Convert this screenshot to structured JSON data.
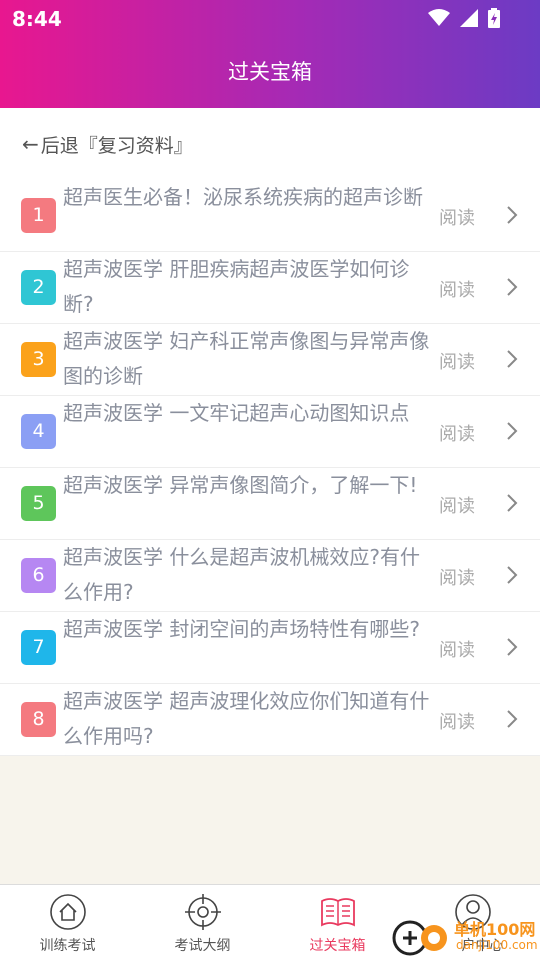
{
  "status": {
    "time": "8:44"
  },
  "header": {
    "title": "过关宝箱"
  },
  "back": {
    "arrow": "←",
    "label": "后退『复习资料』"
  },
  "read_label": "阅读",
  "items": [
    {
      "num": "1",
      "color": "#f47a80",
      "title": "超声医生必备！泌尿系统疾病的超声诊断"
    },
    {
      "num": "2",
      "color": "#2fc6d4",
      "title": "超声波医学 肝胆疾病超声波医学如何诊断?"
    },
    {
      "num": "3",
      "color": "#fba21b",
      "title": "超声波医学 妇产科正常声像图与异常声像图的诊断"
    },
    {
      "num": "4",
      "color": "#8b9ff4",
      "title": "超声波医学 一文牢记超声心动图知识点"
    },
    {
      "num": "5",
      "color": "#5ec65b",
      "title": "超声波医学 异常声像图简介，了解一下!"
    },
    {
      "num": "6",
      "color": "#b687f2",
      "title": "超声波医学 什么是超声波机械效应?有什么作用?"
    },
    {
      "num": "7",
      "color": "#1fb6ea",
      "title": "超声波医学 封闭空间的声场特性有哪些?"
    },
    {
      "num": "8",
      "color": "#f47a80",
      "title": "超声波医学 超声波理化效应你们知道有什么作用吗?"
    }
  ],
  "nav": [
    {
      "label": "训练考试",
      "icon": "home-icon"
    },
    {
      "label": "考试大纲",
      "icon": "target-icon"
    },
    {
      "label": "过关宝箱",
      "icon": "book-icon",
      "active": true
    },
    {
      "label": "户中心",
      "icon": "user-icon"
    }
  ],
  "watermark": {
    "text": "单机100网",
    "sub": "danji100.com"
  }
}
